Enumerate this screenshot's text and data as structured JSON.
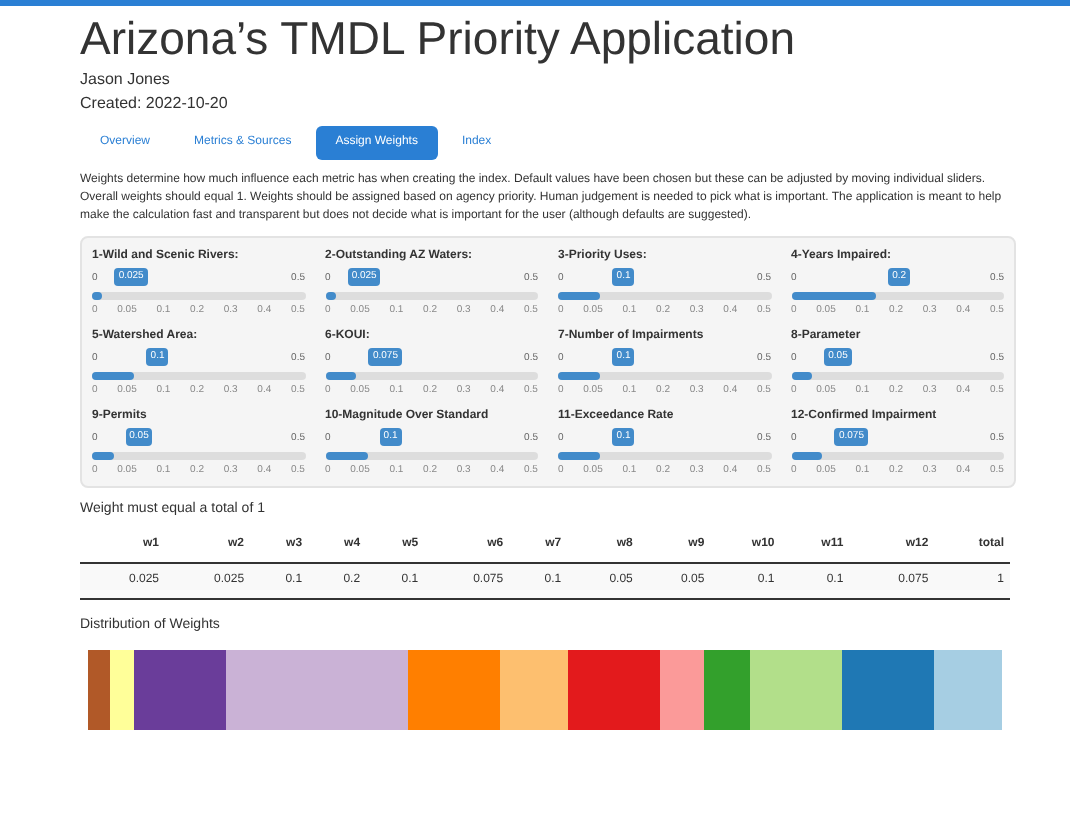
{
  "title": "Arizona’s TMDL Priority Application",
  "author": "Jason Jones",
  "created": "Created: 2022-10-20",
  "tabs": [
    {
      "label": "Overview",
      "selected": false
    },
    {
      "label": "Metrics & Sources",
      "selected": false
    },
    {
      "label": "Assign Weights",
      "selected": true
    },
    {
      "label": "Index",
      "selected": false
    }
  ],
  "intro": "Weights determine how much influence each metric has when creating the index. Default values have been chosen but these can be adjusted by moving individual sliders. Overall weights should equal 1. Weights should be assigned based on agency priority. Human judgement is needed to pick what is important. The application is meant to help make the calculation fast and transparent but does not decide what is important for the user (although defaults are suggested).",
  "sliders": [
    {
      "label": "1-Wild and Scenic Rivers:",
      "min": "0",
      "max": "0.5",
      "value": "0.025",
      "level": 0.05,
      "ticks": [
        "0",
        "0.05",
        "0.1",
        "0.2",
        "0.3",
        "0.4",
        "0.5"
      ]
    },
    {
      "label": "2-Outstanding AZ Waters:",
      "min": "0",
      "max": "0.5",
      "value": "0.025",
      "level": 0.05,
      "ticks": [
        "0",
        "0.05",
        "0.1",
        "0.2",
        "0.3",
        "0.4",
        "0.5"
      ]
    },
    {
      "label": "3-Priority Uses:",
      "min": "0",
      "max": "0.5",
      "value": "0.1",
      "level": 0.2,
      "ticks": [
        "0",
        "0.05",
        "0.1",
        "0.2",
        "0.3",
        "0.4",
        "0.5"
      ]
    },
    {
      "label": "4-Years Impaired:",
      "min": "0",
      "max": "0.5",
      "value": "0.2",
      "level": 0.4,
      "ticks": [
        "0",
        "0.05",
        "0.1",
        "0.2",
        "0.3",
        "0.4",
        "0.5"
      ]
    },
    {
      "label": "5-Watershed Area:",
      "min": "0",
      "max": "0.5",
      "value": "0.1",
      "level": 0.2,
      "ticks": [
        "0",
        "0.05",
        "0.1",
        "0.2",
        "0.3",
        "0.4",
        "0.5"
      ]
    },
    {
      "label": "6-KOUI:",
      "min": "0",
      "max": "0.5",
      "value": "0.075",
      "level": 0.15,
      "ticks": [
        "0",
        "0.05",
        "0.1",
        "0.2",
        "0.3",
        "0.4",
        "0.5"
      ]
    },
    {
      "label": "7-Number of Impairments",
      "min": "0",
      "max": "0.5",
      "value": "0.1",
      "level": 0.2,
      "ticks": [
        "0",
        "0.05",
        "0.1",
        "0.2",
        "0.3",
        "0.4",
        "0.5"
      ]
    },
    {
      "label": "8-Parameter",
      "min": "0",
      "max": "0.5",
      "value": "0.05",
      "level": 0.1,
      "ticks": [
        "0",
        "0.05",
        "0.1",
        "0.2",
        "0.3",
        "0.4",
        "0.5"
      ]
    },
    {
      "label": "9-Permits",
      "min": "0",
      "max": "0.5",
      "value": "0.05",
      "level": 0.1,
      "ticks": [
        "0",
        "0.05",
        "0.1",
        "0.2",
        "0.3",
        "0.4",
        "0.5"
      ]
    },
    {
      "label": "10-Magnitude Over Standard",
      "min": "0",
      "max": "0.5",
      "value": "0.1",
      "level": 0.2,
      "ticks": [
        "0",
        "0.05",
        "0.1",
        "0.2",
        "0.3",
        "0.4",
        "0.5"
      ]
    },
    {
      "label": "11-Exceedance Rate",
      "min": "0",
      "max": "0.5",
      "value": "0.1",
      "level": 0.2,
      "ticks": [
        "0",
        "0.05",
        "0.1",
        "0.2",
        "0.3",
        "0.4",
        "0.5"
      ]
    },
    {
      "label": "12-Confirmed Impairment",
      "min": "0",
      "max": "0.5",
      "value": "0.075",
      "level": 0.15,
      "ticks": [
        "0",
        "0.05",
        "0.1",
        "0.2",
        "0.3",
        "0.4",
        "0.5"
      ]
    }
  ],
  "total_note": "Weight must equal a total of 1",
  "table": {
    "columns": [
      "w1",
      "w2",
      "w3",
      "w4",
      "w5",
      "w6",
      "w7",
      "w8",
      "w9",
      "w10",
      "w11",
      "w12",
      "total"
    ],
    "row": [
      "0.025",
      "0.025",
      "0.1",
      "0.2",
      "0.1",
      "0.075",
      "0.1",
      "0.05",
      "0.05",
      "0.1",
      "0.1",
      "0.075",
      "1"
    ]
  },
  "distribution": {
    "title": "Distribution of Weights",
    "segments": [
      {
        "color": "#b15928"
      },
      {
        "color": "#ffff99"
      },
      {
        "color": "#6a3d9a"
      },
      {
        "color": "#cab2d6"
      },
      {
        "color": "#ff7f00"
      },
      {
        "color": "#fdbf6f"
      },
      {
        "color": "#e31a1c"
      },
      {
        "color": "#fb9a99"
      },
      {
        "color": "#33a02c"
      },
      {
        "color": "#b2df8a"
      },
      {
        "color": "#1f78b4"
      },
      {
        "color": "#a6cee3"
      }
    ]
  }
}
